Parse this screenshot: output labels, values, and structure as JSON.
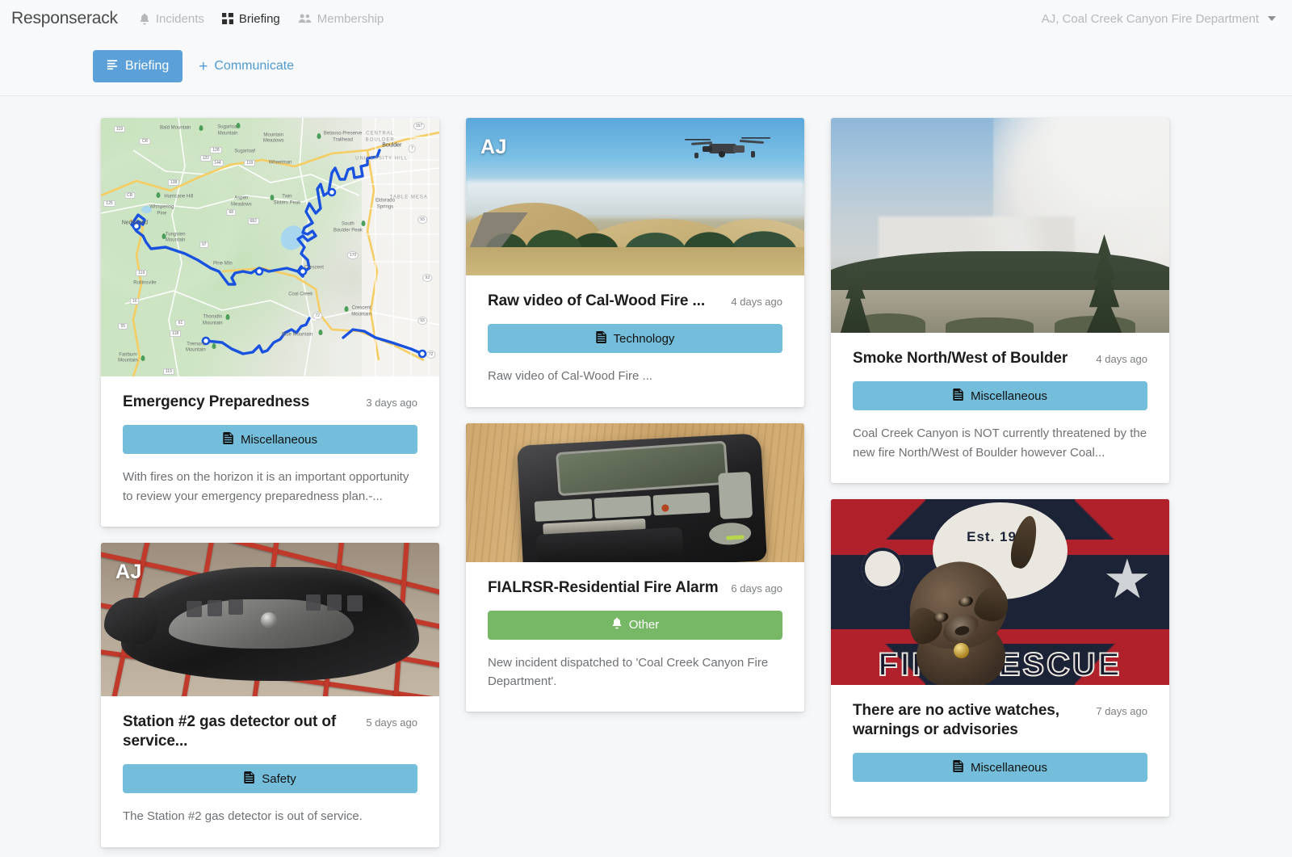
{
  "header": {
    "brand": "Responserack",
    "nav": [
      {
        "label": "Incidents",
        "icon": "bell-icon",
        "active": false
      },
      {
        "label": "Briefing",
        "icon": "grid-icon",
        "active": true
      },
      {
        "label": "Membership",
        "icon": "people-icon",
        "active": false
      }
    ],
    "account": "AJ, Coal Creek Canyon Fire Department",
    "account_caret": "chevron-down-icon"
  },
  "toolbar": {
    "briefing_label": "Briefing",
    "briefing_icon": "list-icon",
    "communicate_label": "Communicate",
    "communicate_plus": "+",
    "briefing_color": "#5ba0d8",
    "communicate_color": "#4e9bd4"
  },
  "colors": {
    "badge_blue": "#74bedb",
    "badge_green": "#76b865",
    "page_background": "#f6f7f8",
    "card_background": "#ffffff"
  },
  "cards": [
    {
      "id": "emergency-preparedness",
      "media": "map",
      "overlay_initials": "",
      "title": "Emergency Preparedness",
      "age": "3 days ago",
      "badge_label": "Miscellaneous",
      "badge_icon": "document-icon",
      "badge_style": "blue",
      "excerpt": "With fires on the horizon it is an important opportunity to review your emergency preparedness plan.-..."
    },
    {
      "id": "raw-video-cal-wood-fire",
      "media": "drone",
      "overlay_initials": "AJ",
      "title": "Raw video of Cal-Wood Fire ...",
      "age": "4 days ago",
      "badge_label": "Technology",
      "badge_icon": "document-icon",
      "badge_style": "blue",
      "excerpt": "Raw video of Cal-Wood Fire ..."
    },
    {
      "id": "smoke-north-west-boulder",
      "media": "smoke",
      "overlay_initials": "",
      "title": "Smoke North/West of Boulder",
      "age": "4 days ago",
      "badge_label": "Miscellaneous",
      "badge_icon": "document-icon",
      "badge_style": "blue",
      "excerpt": "Coal Creek Canyon is NOT currently threatened by the new fire North/West of Boulder however Coal..."
    },
    {
      "id": "station-2-gas-detector",
      "media": "goggles",
      "overlay_initials": "AJ",
      "title": "Station #2 gas detector out of service...",
      "age": "5 days ago",
      "badge_label": "Safety",
      "badge_icon": "document-icon",
      "badge_style": "blue",
      "excerpt": "The Station #2 gas detector is out of service."
    },
    {
      "id": "fialrsr-residential-fire-alarm",
      "media": "pager",
      "overlay_initials": "",
      "title": "FIALRSR-Residential Fire Alarm",
      "age": "6 days ago",
      "badge_label": "Other",
      "badge_icon": "bell-icon",
      "badge_style": "green",
      "excerpt": "New incident dispatched to 'Coal Creek Canyon Fire Department'."
    },
    {
      "id": "no-active-watches",
      "media": "dog",
      "overlay_initials": "",
      "title": "There are no active watches, warnings or advisories",
      "age": "7 days ago",
      "badge_label": "Miscellaneous",
      "badge_icon": "document-icon",
      "badge_style": "blue",
      "excerpt": ""
    }
  ],
  "map_image": {
    "labels": [
      "Bald Mountain",
      "Sugarloaf Mountain",
      "Mountain Meadows",
      "Betasso Preserve Trailhead",
      "Sugarloaf",
      "Wheelman",
      "Hurricane Hill",
      "Aspen Meadows",
      "Twin Sisters Peak",
      "Whispering Pine",
      "Nederland",
      "Tungsten Mountain",
      "South Boulder Peak",
      "Boulder",
      "CENTRAL BOULDER",
      "UNIVERSITY HILL",
      "TABLE MESA",
      "Eldorado Springs",
      "Rollinsville",
      "Pine Mtn",
      "Crescent",
      "Coal Creek",
      "Crescent Mountain",
      "Thorodin Mountain",
      "Blue Mountain",
      "Tremont Mountain",
      "Fairburn Mountain"
    ],
    "route_color": "#1a52e0"
  },
  "dog_image": {
    "rug_text_top": "Est. 1946",
    "rug_text_bottom": "FIRE RESCUE"
  }
}
